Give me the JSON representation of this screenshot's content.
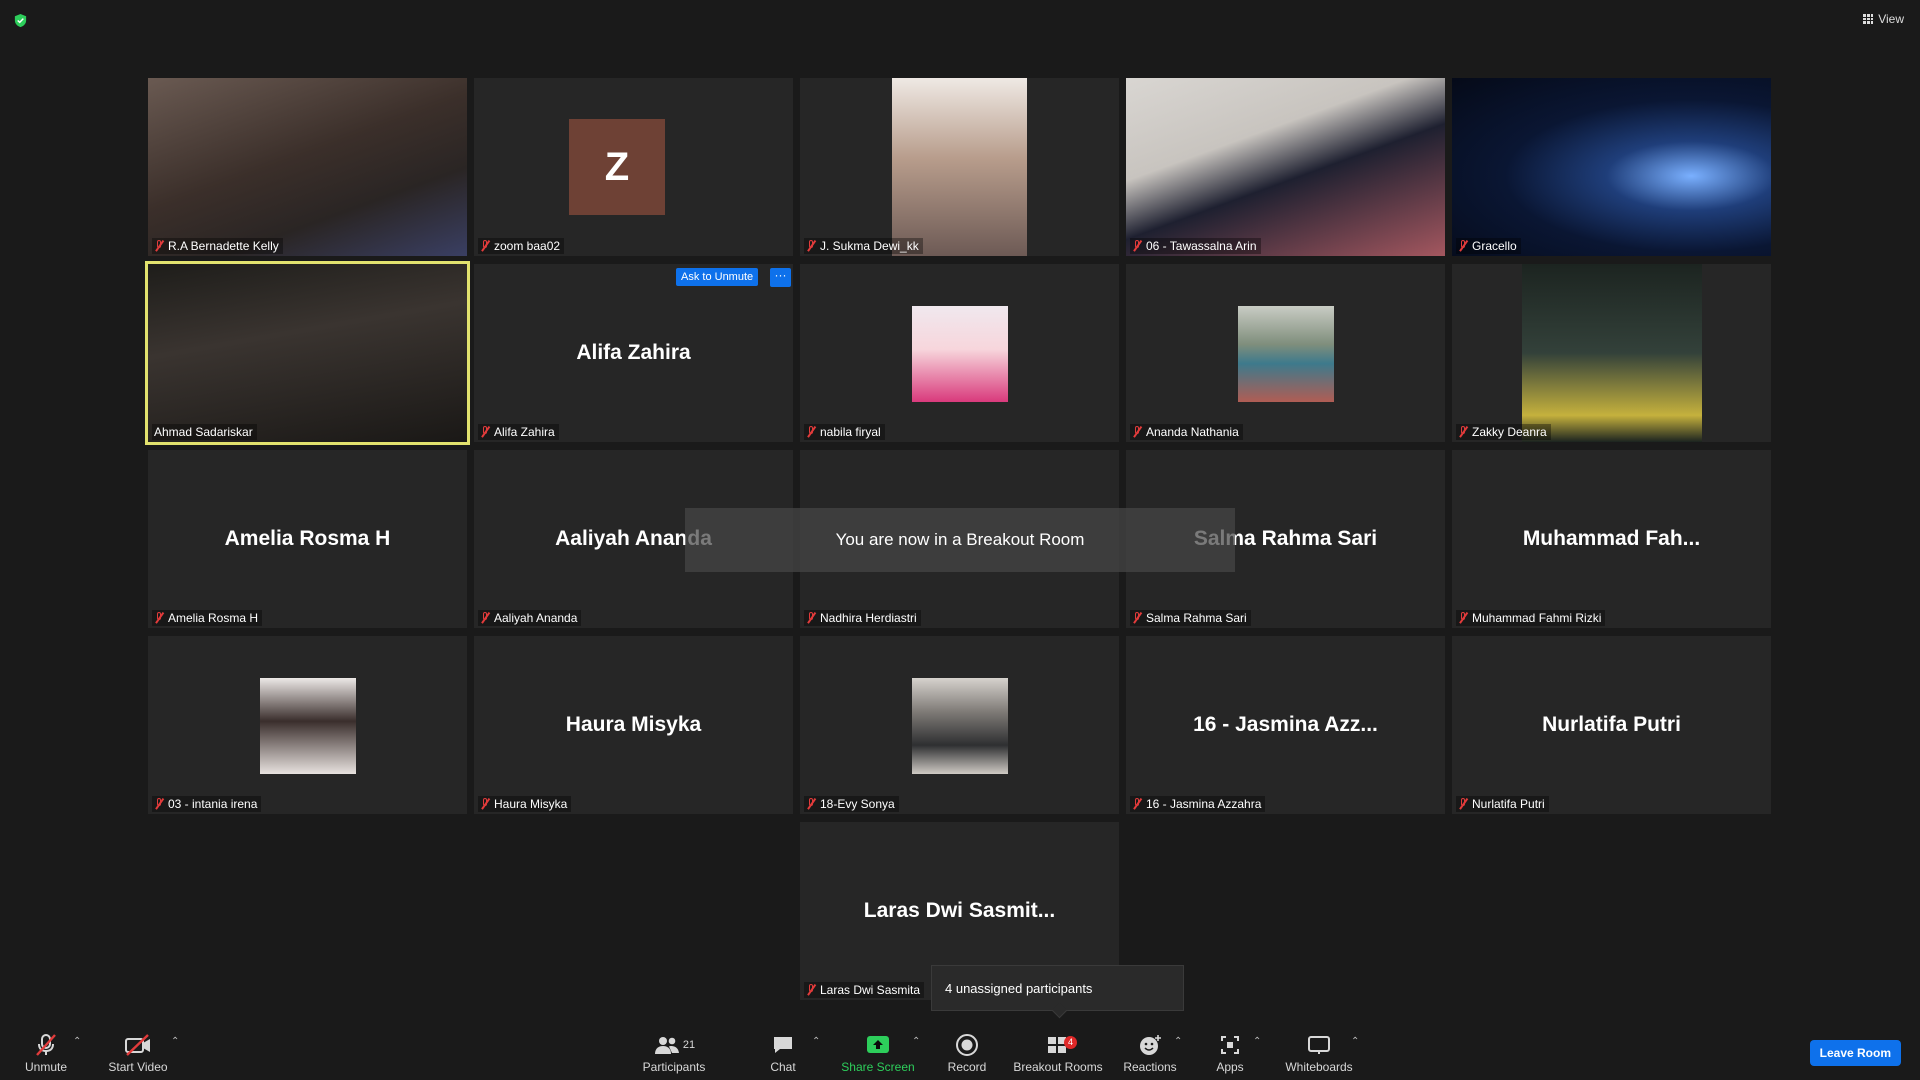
{
  "topbar": {
    "view_label": "View"
  },
  "tiles": [
    {
      "label": "R.A Bernadette Kelly"
    },
    {
      "label": "zoom baa02",
      "avatar_letter": "Z"
    },
    {
      "label": "J. Sukma Dewi_kk"
    },
    {
      "label": "06 - Tawassalna Arin"
    },
    {
      "label": "Gracello"
    },
    {
      "label": "Ahmad Sadariskar"
    },
    {
      "label": "Alifa Zahira",
      "big_name": "Alifa Zahira"
    },
    {
      "label": "nabila firyal"
    },
    {
      "label": "Ananda Nathania"
    },
    {
      "label": "Zakky Deanra"
    },
    {
      "label": "Amelia Rosma H",
      "big_name": "Amelia Rosma H"
    },
    {
      "label": "Aaliyah Ananda",
      "big_name": "Aaliyah Ananda"
    },
    {
      "label": "Nadhira Herdiastri"
    },
    {
      "label": "Salma Rahma Sari",
      "big_name": "Salma Rahma Sari"
    },
    {
      "label": "Muhammad Fahmi Rizki",
      "big_name": "Muhammad  Fah..."
    },
    {
      "label": "03 - intania irena"
    },
    {
      "label": "Haura Misyka",
      "big_name": "Haura Misyka"
    },
    {
      "label": "18-Evy Sonya"
    },
    {
      "label": "16 - Jasmina Azzahra",
      "big_name": "16 - Jasmina Azz..."
    },
    {
      "label": "Nurlatifa Putri",
      "big_name": "Nurlatifa Putri"
    },
    {
      "label": "Laras Dwi Sasmita",
      "big_name": "Laras Dwi Sasmit..."
    }
  ],
  "tile_actions": {
    "ask_to_unmute": "Ask to Unmute",
    "more": "···"
  },
  "breakout_banner": "You are now in a Breakout Room",
  "unassigned_popup": "4 unassigned participants",
  "toolbar": {
    "unmute": "Unmute",
    "start_video": "Start Video",
    "participants": "Participants",
    "participants_count": "21",
    "chat": "Chat",
    "share_screen": "Share Screen",
    "record": "Record",
    "breakout_rooms": "Breakout Rooms",
    "breakout_badge": "4",
    "reactions": "Reactions",
    "apps": "Apps",
    "whiteboards": "Whiteboards",
    "leave_room": "Leave Room"
  },
  "colors": {
    "active_speaker": "#e2e26e",
    "accent": "#0e71eb",
    "share_green": "#2dce5b",
    "muted_red": "#e23b3b"
  }
}
